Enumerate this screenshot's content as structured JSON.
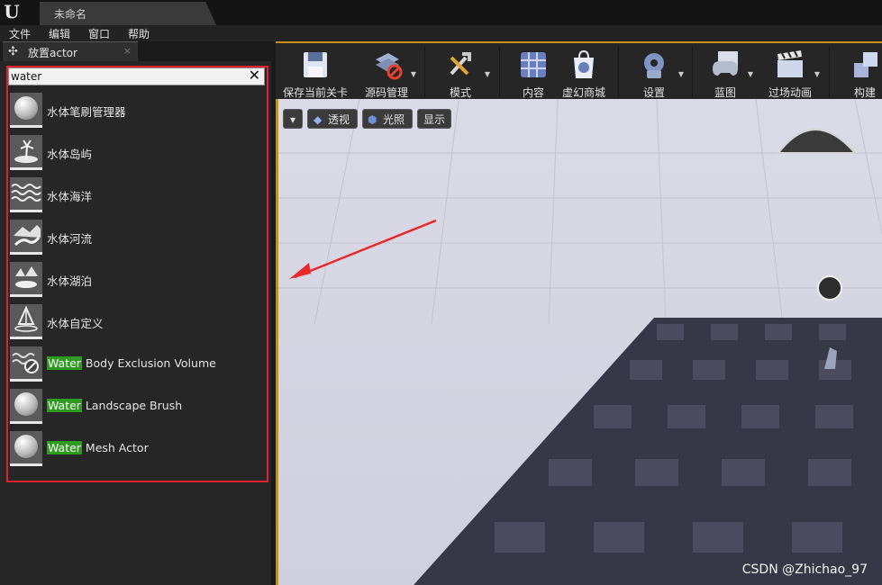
{
  "window": {
    "logo": "U",
    "tab_title": "未命名"
  },
  "menu": {
    "items": [
      "文件",
      "编辑",
      "窗口",
      "帮助"
    ]
  },
  "panel": {
    "tab_title": "放置actor",
    "tab_close": "×"
  },
  "search": {
    "value": "water",
    "clear_icon": "✕"
  },
  "results": [
    {
      "icon": "sphere",
      "label": "水体笔刷管理器",
      "highlight": ""
    },
    {
      "icon": "island",
      "label": "水体岛屿",
      "highlight": ""
    },
    {
      "icon": "ocean",
      "label": "水体海洋",
      "highlight": ""
    },
    {
      "icon": "river",
      "label": "水体河流",
      "highlight": ""
    },
    {
      "icon": "lake",
      "label": "水体湖泊",
      "highlight": ""
    },
    {
      "icon": "custom",
      "label": "水体自定义",
      "highlight": ""
    },
    {
      "icon": "exclusion",
      "label": " Body Exclusion Volume",
      "highlight": "Water"
    },
    {
      "icon": "sphere",
      "label": " Landscape Brush",
      "highlight": "Water"
    },
    {
      "icon": "sphere",
      "label": " Mesh Actor",
      "highlight": "Water"
    }
  ],
  "toolbar": {
    "save": "保存当前关卡",
    "source": "源码管理",
    "modes": "模式",
    "content": "内容",
    "marketplace": "虚幻商城",
    "settings": "设置",
    "blueprints": "蓝图",
    "cinematics": "过场动画",
    "build": "构建"
  },
  "viewport": {
    "perspective": "透视",
    "lit": "光照",
    "show": "显示"
  },
  "watermark": "CSDN @Zhichao_97"
}
